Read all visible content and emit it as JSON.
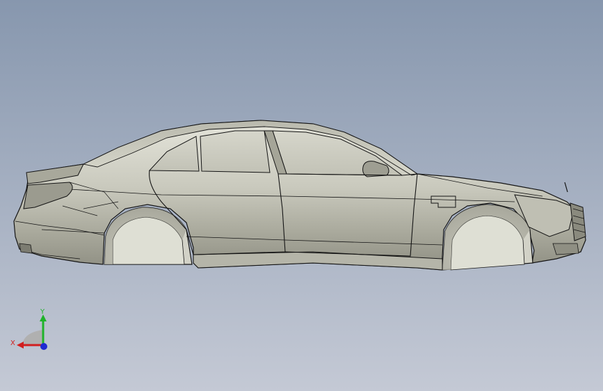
{
  "viewport": {
    "background_top": "#8797ae",
    "background_bottom": "#c4c9d5"
  },
  "model": {
    "body_color": "#cfcfc4",
    "edge_color": "#141414"
  },
  "triad": {
    "x_label": "X",
    "y_label": "Y",
    "x_color": "#d11f1f",
    "y_color": "#1fb32a",
    "z_color": "#1f2ad1"
  }
}
